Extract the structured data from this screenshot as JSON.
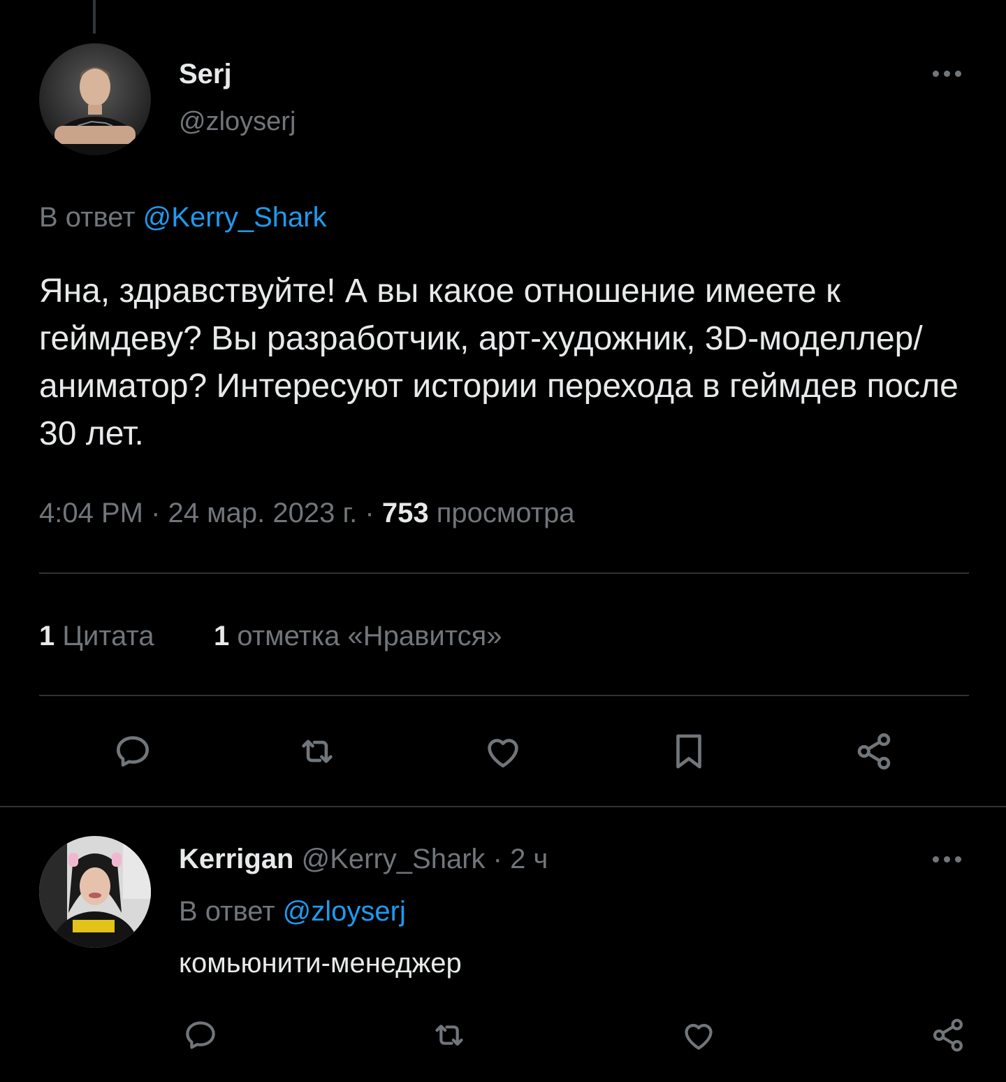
{
  "main_tweet": {
    "author_name": "Serj",
    "author_handle": "@zloyserj",
    "reply_prefix": "В ответ",
    "reply_to": "@Kerry_Shark",
    "text": "Яна, здравствуйте! А вы какое отношение имеете к геймдеву? Вы разработчик, арт-художник, 3D-моделлер/аниматор? Интересуют истории перехода в геймдев после 30 лет.",
    "time": "4:04 PM",
    "sep": "·",
    "date": "24 мар. 2023 г.",
    "views_count": "753",
    "views_label": "просмотра",
    "stats": {
      "quotes_count": "1",
      "quotes_label": "Цитата",
      "likes_count": "1",
      "likes_label": "отметка «Нравится»"
    },
    "actions": [
      "reply-icon",
      "retweet-icon",
      "like-icon",
      "bookmark-icon",
      "share-icon"
    ]
  },
  "reply_tweet": {
    "author_name": "Kerrigan",
    "author_handle": "@Kerry_Shark",
    "sep": "·",
    "time_ago": "2 ч",
    "reply_prefix": "В ответ",
    "reply_to": "@zloyserj",
    "text": "комьюнити-менеджер",
    "actions": [
      "reply-icon",
      "retweet-icon",
      "like-icon",
      "share-icon"
    ]
  },
  "colors": {
    "background": "#000000",
    "text": "#e7e9ea",
    "muted": "#71767b",
    "accent": "#1d9bf0",
    "divider": "#2f3336"
  }
}
